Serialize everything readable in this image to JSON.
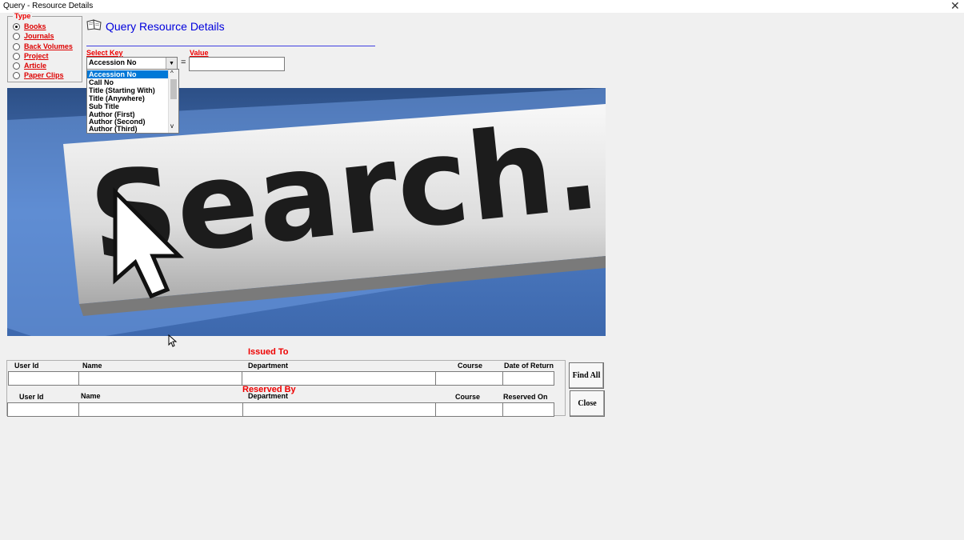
{
  "window": {
    "title": "Query - Resource Details",
    "close_glyph": "✕"
  },
  "type_group": {
    "legend": "Type",
    "options": [
      {
        "label": "Books",
        "selected": true
      },
      {
        "label": "Journals",
        "selected": false
      },
      {
        "label": "Back Volumes",
        "selected": false
      },
      {
        "label": "Project",
        "selected": false
      },
      {
        "label": "Article",
        "selected": false
      },
      {
        "label": "Paper Clips",
        "selected": false
      }
    ]
  },
  "header": {
    "title": "Query Resource  Details",
    "icon": "open-book-icon"
  },
  "query": {
    "select_key_label": "Select Key",
    "value_label": "Value",
    "selected_key": "Accession No",
    "equals": "=",
    "value": "",
    "key_options": [
      "Accession No",
      "Call No",
      "Title (Starting With)",
      "Title (Anywhere)",
      "Sub Title",
      "Author (First)",
      "Author (Second)",
      "Author (Third)"
    ]
  },
  "hero": {
    "text": "Search..."
  },
  "issued": {
    "title": "Issued To",
    "headers": [
      "User Id",
      "Name",
      "Department",
      "Course",
      "Date of Return"
    ],
    "values": [
      "",
      "",
      "",
      "",
      ""
    ]
  },
  "reserved": {
    "title": "Reserved By",
    "headers": [
      "User Id",
      "Name",
      "Department",
      "Course",
      "Reserved On"
    ],
    "values": [
      "",
      "",
      "",
      "",
      ""
    ]
  },
  "buttons": {
    "find_all": "Find All",
    "close": "Close"
  },
  "colors": {
    "accent_red": "#e00000",
    "heading_blue": "#0000dd",
    "selection": "#0078d7"
  }
}
